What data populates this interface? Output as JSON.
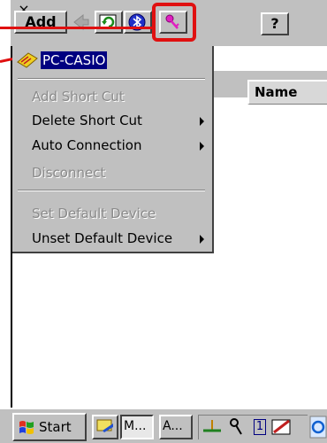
{
  "toolbar": {
    "add_label": "Add",
    "help_label": "?",
    "close_label": "×"
  },
  "list": {
    "name_column": "Name"
  },
  "menu": {
    "device_name": "PC-CASIO",
    "items": [
      {
        "label": "Add Short Cut",
        "enabled": false,
        "submenu": false
      },
      {
        "label": "Delete Short Cut",
        "enabled": true,
        "submenu": true
      },
      {
        "label": "Auto Connection",
        "enabled": true,
        "submenu": true
      },
      {
        "label": "Disconnect",
        "enabled": false,
        "submenu": false
      },
      {
        "label": "Set Default Device",
        "enabled": false,
        "submenu": false
      },
      {
        "label": "Unset Default Device",
        "enabled": true,
        "submenu": true
      }
    ]
  },
  "taskbar": {
    "start_label": "Start",
    "tasks": [
      "M...",
      "A..."
    ],
    "tray_number": "1"
  },
  "colors": {
    "highlight": "#e01010",
    "selection": "#000080",
    "face": "#c0c0c0"
  }
}
